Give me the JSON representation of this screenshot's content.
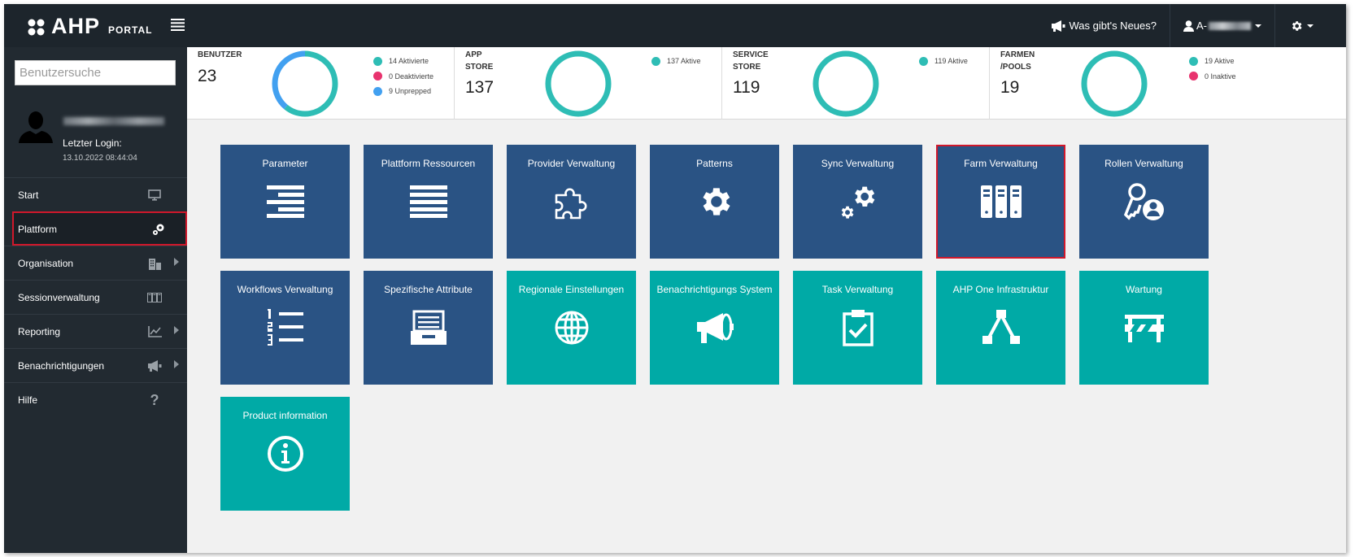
{
  "header": {
    "logo_main": "AHP",
    "logo_sub": "PORTAL",
    "news_label": "Was gibt's Neues?",
    "user_prefix": "A-"
  },
  "sidebar": {
    "search_placeholder": "Benutzersuche",
    "last_login_label": "Letzter Login:",
    "last_login_value": "13.10.2022 08:44:04",
    "items": [
      {
        "label": "Start",
        "icon": "monitor-icon"
      },
      {
        "label": "Plattform",
        "icon": "gears-icon"
      },
      {
        "label": "Organisation",
        "icon": "building-icon"
      },
      {
        "label": "Sessionverwaltung",
        "icon": "sessions-icon"
      },
      {
        "label": "Reporting",
        "icon": "line-chart-icon"
      },
      {
        "label": "Benachrichtigungen",
        "icon": "megaphone-icon"
      },
      {
        "label": "Hilfe",
        "icon": "question-icon"
      }
    ]
  },
  "stats": [
    {
      "title_line1": "BENUTZER",
      "title_line2": "",
      "value": "23",
      "legend": [
        {
          "label": "14 Aktivierte",
          "color": "#2ebdb5"
        },
        {
          "label": "0 Deaktivierte",
          "color": "#e8336e"
        },
        {
          "label": "9 Unprepped",
          "color": "#42a0f0"
        }
      ],
      "segments": [
        {
          "value": 14,
          "color": "#2ebdb5"
        },
        {
          "value": 0,
          "color": "#e8336e"
        },
        {
          "value": 9,
          "color": "#42a0f0"
        }
      ]
    },
    {
      "title_line1": "APP",
      "title_line2": "STORE",
      "value": "137",
      "legend": [
        {
          "label": "137 Aktive",
          "color": "#2ebdb5"
        }
      ],
      "segments": [
        {
          "value": 137,
          "color": "#2ebdb5"
        }
      ]
    },
    {
      "title_line1": "SERVICE",
      "title_line2": "STORE",
      "value": "119",
      "legend": [
        {
          "label": "119 Aktive",
          "color": "#2ebdb5"
        }
      ],
      "segments": [
        {
          "value": 119,
          "color": "#2ebdb5"
        }
      ]
    },
    {
      "title_line1": "FARMEN",
      "title_line2": "/POOLS",
      "value": "19",
      "legend": [
        {
          "label": "19 Aktive",
          "color": "#2ebdb5"
        },
        {
          "label": "0 Inaktive",
          "color": "#e8336e"
        }
      ],
      "segments": [
        {
          "value": 19,
          "color": "#2ebdb5"
        },
        {
          "value": 0,
          "color": "#e8336e"
        }
      ]
    }
  ],
  "tiles": [
    {
      "label": "Parameter",
      "icon": "align-right-icon",
      "color": "blue"
    },
    {
      "label": "Plattform Ressourcen",
      "icon": "list-icon",
      "color": "blue"
    },
    {
      "label": "Provider Verwaltung",
      "icon": "puzzle-icon",
      "color": "blue"
    },
    {
      "label": "Patterns",
      "icon": "gear-icon",
      "color": "blue"
    },
    {
      "label": "Sync Verwaltung",
      "icon": "gears-icon",
      "color": "blue"
    },
    {
      "label": "Farm Verwaltung",
      "icon": "servers-icon",
      "color": "blue"
    },
    {
      "label": "Rollen Verwaltung",
      "icon": "key-user-icon",
      "color": "blue"
    },
    {
      "label": "Workflows Verwaltung",
      "icon": "numbered-list-icon",
      "color": "blue"
    },
    {
      "label": "Spezifische Attribute",
      "icon": "archive-icon",
      "color": "blue"
    },
    {
      "label": "Regionale Einstellungen",
      "icon": "globe-icon",
      "color": "teal"
    },
    {
      "label": "Benachrichtigungs System",
      "icon": "megaphone-icon",
      "color": "teal"
    },
    {
      "label": "Task Verwaltung",
      "icon": "clipboard-check-icon",
      "color": "teal"
    },
    {
      "label": "AHP One Infrastruktur",
      "icon": "network-icon",
      "color": "teal"
    },
    {
      "label": "Wartung",
      "icon": "barrier-icon",
      "color": "teal"
    },
    {
      "label": "Product information",
      "icon": "info-icon",
      "color": "teal"
    }
  ]
}
